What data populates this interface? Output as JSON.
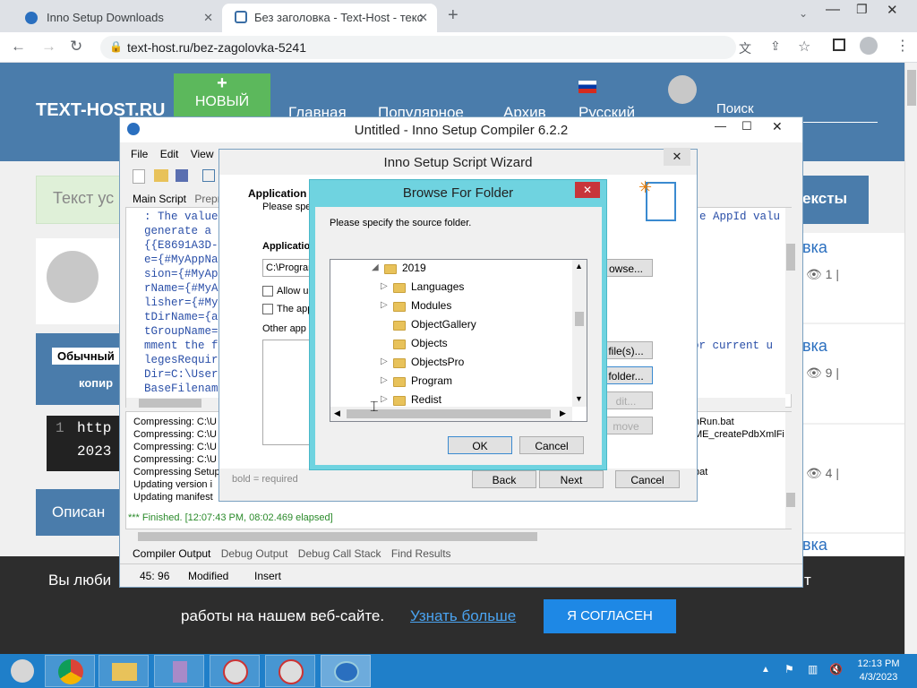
{
  "browser": {
    "tabs": [
      {
        "title": "Inno Setup Downloads"
      },
      {
        "title": "Без заголовка - Text-Host - текс"
      }
    ],
    "url": "text-host.ru/bez-zagolovka-5241"
  },
  "site": {
    "logo": "TEXT-HOST.RU",
    "new_button": "НОВЫЙ",
    "new_plus": "+",
    "nav": [
      "Главная",
      "Популярное",
      "Архив",
      "Русский"
    ],
    "search": "Поиск",
    "text_placeholder": "Текст ус",
    "sidebar_title": "ексты",
    "right_links": [
      "вка",
      "вка",
      "вка",
      "вка"
    ],
    "right_counts": [
      "1 |",
      "9 |",
      "4 |"
    ],
    "left_btn1": "Обычный",
    "left_btn2": "копир",
    "code_line_num": "1",
    "code_text1": "http",
    "code_text2": "2023",
    "description": "Описан",
    "cookie_text1": "Вы люби",
    "cookie_text1_end": "т",
    "cookie_text2": "работы на нашем веб-сайте.",
    "cookie_link": "Узнать больше",
    "cookie_button": "Я СОГЛАСЕН"
  },
  "inno": {
    "title": "Untitled - Inno Setup Compiler 6.2.2",
    "menu": [
      "File",
      "Edit",
      "View"
    ],
    "tabs": [
      "Main Script",
      "Prepr"
    ],
    "code_lines": [
      ": The value",
      "generate a",
      "{{E8691A3D-",
      "e={#MyAppNa",
      "sion={#MyAp",
      "rName={#MyA",
      "lisher={#My",
      "tDirName={a",
      "tGroupName=",
      "mment the f",
      "legesRequir",
      "Dir=C:\\User",
      "BaseFilenam"
    ],
    "code_right": "e AppId valu",
    "code_right2": "or current u",
    "output_lines": [
      "Compressing: C:\\U",
      "Compressing: C:\\U",
      "Compressing: C:\\U",
      "Compressing: C:\\U",
      "Compressing Setup",
      "Updating version i",
      "Updating manifest"
    ],
    "output_right": [
      "nRun.bat",
      "ME_createPdbXmlFi",
      "",
      "",
      "bat"
    ],
    "finished": "*** Finished.  [12:07:43 PM, 08:02.469 elapsed]",
    "bottom_tabs": [
      "Compiler Output",
      "Debug Output",
      "Debug Call Stack",
      "Find Results"
    ],
    "status": {
      "position": "45:  96",
      "modified": "Modified",
      "mode": "Insert"
    }
  },
  "wizard": {
    "title": "Inno Setup Script Wizard",
    "heading": "Application F",
    "subheading": "Please spe",
    "folder_label": "Application",
    "folder_value": "C:\\Program",
    "allow_label": "Allow u",
    "the_app_label": "The app",
    "other_label": "Other app",
    "browse_btn": "owse...",
    "files_btn": "file(s)...",
    "folder_btn": "folder...",
    "edit_btn": "dit...",
    "remove_btn": "move",
    "required_note": "bold = required",
    "required_bold": "bold",
    "back": "Back",
    "next": "Next",
    "cancel": "Cancel"
  },
  "browse": {
    "title": "Browse For Folder",
    "prompt": "Please specify the source folder.",
    "tree": [
      {
        "label": "2019",
        "expanded": true,
        "level": 0
      },
      {
        "label": "Languages",
        "expanded": false,
        "level": 1
      },
      {
        "label": "Modules",
        "expanded": false,
        "level": 1
      },
      {
        "label": "ObjectGallery",
        "expanded": null,
        "level": 1
      },
      {
        "label": "Objects",
        "expanded": null,
        "level": 1
      },
      {
        "label": "ObjectsPro",
        "expanded": false,
        "level": 1
      },
      {
        "label": "Program",
        "expanded": false,
        "level": 1
      },
      {
        "label": "Redist",
        "expanded": false,
        "level": 1
      }
    ],
    "ok": "OK",
    "cancel": "Cancel"
  },
  "taskbar": {
    "time": "12:13 PM",
    "date": "4/3/2023"
  }
}
